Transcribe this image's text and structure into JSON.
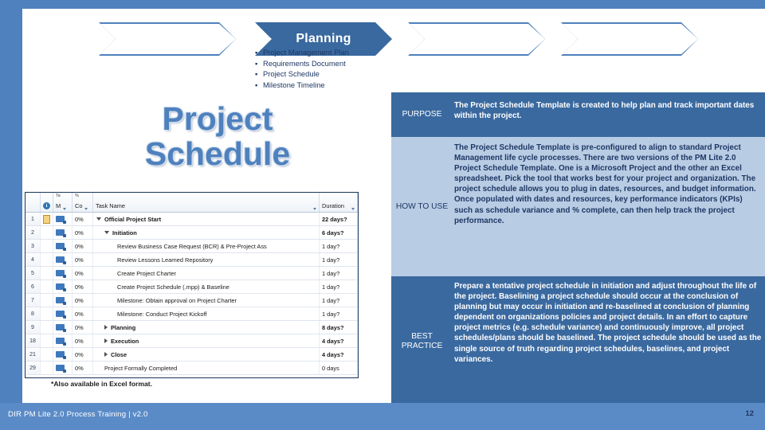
{
  "slide": {
    "page_number": "12",
    "footer_text": "DIR PM Lite 2.0 Process Training | v2.0",
    "title": "Project Schedule",
    "footnote": "*Also available in Excel format."
  },
  "process_chevrons": [
    {
      "label": "",
      "active": false
    },
    {
      "label": "Planning",
      "active": true
    },
    {
      "label": "",
      "active": false
    },
    {
      "label": "",
      "active": false
    }
  ],
  "deliverables": [
    "Project Management Plan",
    "Requirements Document",
    "Project Schedule",
    "Milestone Timeline"
  ],
  "info_table": [
    {
      "key": "PURPOSE",
      "value": "The Project Schedule Template is created to help plan and track important dates within the project.",
      "style": "dark"
    },
    {
      "key": "HOW TO USE",
      "value": "The Project Schedule Template is pre-configured to align to standard Project Management life cycle processes. There are two versions of the PM Lite 2.0 Project Schedule Template. One is a Microsoft Project and the other an Excel spreadsheet. Pick the tool that works best for your project and organization. The project schedule allows you to plug in dates, resources, and budget information. Once populated with dates and resources, key performance indicators (KPIs) such as schedule variance and % complete, can then help track the project performance.",
      "style": "light"
    },
    {
      "key": "BEST PRACTICE",
      "value": "Prepare a tentative project schedule in initiation and adjust throughout the life of the project.  Baselining a project schedule should occur at the conclusion of planning but may occur in initiation and re-baselined at conclusion of planning dependent on organizations policies and project details.  In an effort to capture project metrics (e.g. schedule variance) and continuously improve, all project schedules/plans should be baselined.  The project schedule should be used as the single source of truth regarding project schedules, baselines, and project variances.",
      "style": "dark"
    }
  ],
  "gantt": {
    "columns": {
      "id": "",
      "indicators": "i",
      "task_mode_top": "Ta",
      "task_mode": "M",
      "pct_top": "%",
      "pct": "Co",
      "task_name": "Task Name",
      "duration": "Duration"
    },
    "rows": [
      {
        "id": "1",
        "pct": "0%",
        "name": "Official Project Start",
        "duration": "22 days?",
        "level": 0,
        "summary": true,
        "toggle": "open",
        "note": true
      },
      {
        "id": "2",
        "pct": "0%",
        "name": "Initiation",
        "duration": "6 days?",
        "level": 1,
        "summary": true,
        "toggle": "open",
        "note": false
      },
      {
        "id": "3",
        "pct": "0%",
        "name": "Review Business Case Request (BCR) & Pre-Project Ass",
        "duration": "1 day?",
        "level": 2,
        "summary": false,
        "toggle": "",
        "note": false
      },
      {
        "id": "4",
        "pct": "0%",
        "name": "Review Lessons Learned Repository",
        "duration": "1 day?",
        "level": 2,
        "summary": false,
        "toggle": "",
        "note": false
      },
      {
        "id": "5",
        "pct": "0%",
        "name": "Create Project Charter",
        "duration": "1 day?",
        "level": 2,
        "summary": false,
        "toggle": "",
        "note": false
      },
      {
        "id": "6",
        "pct": "0%",
        "name": "Create Project Schedule (.mpp) & Baseline",
        "duration": "1 day?",
        "level": 2,
        "summary": false,
        "toggle": "",
        "note": false
      },
      {
        "id": "7",
        "pct": "0%",
        "name": "Milestone: Obtain approval on Project Charter",
        "duration": "1 day?",
        "level": 2,
        "summary": false,
        "toggle": "",
        "note": false
      },
      {
        "id": "8",
        "pct": "0%",
        "name": "Milestone: Conduct Project Kickoff",
        "duration": "1 day?",
        "level": 2,
        "summary": false,
        "toggle": "",
        "note": false
      },
      {
        "id": "9",
        "pct": "0%",
        "name": "Planning",
        "duration": "8 days?",
        "level": 1,
        "summary": true,
        "toggle": "closed",
        "note": false
      },
      {
        "id": "18",
        "pct": "0%",
        "name": "Execution",
        "duration": "4 days?",
        "level": 1,
        "summary": true,
        "toggle": "closed",
        "note": false
      },
      {
        "id": "21",
        "pct": "0%",
        "name": "Close",
        "duration": "4 days?",
        "level": 1,
        "summary": true,
        "toggle": "closed",
        "note": false
      },
      {
        "id": "29",
        "pct": "0%",
        "name": "Project Formally Completed",
        "duration": "0 days",
        "level": 1,
        "summary": false,
        "toggle": "",
        "note": false
      }
    ]
  },
  "colors": {
    "frame_blue": "#4e81bd",
    "chevron_fill": "#39699f",
    "row_dark": "#3a699f",
    "row_light": "#b8cce4",
    "title_blue": "#4e81bd",
    "footer_blue": "#5b8bc7"
  }
}
